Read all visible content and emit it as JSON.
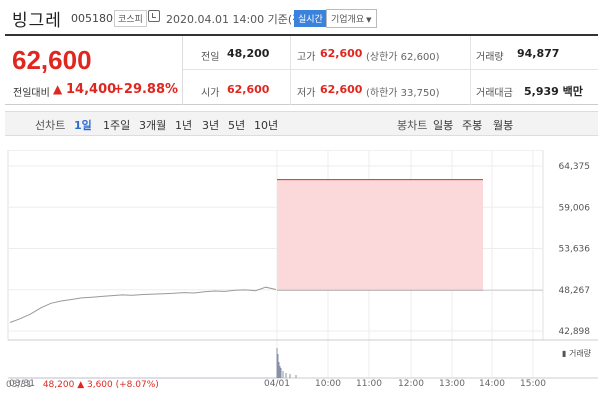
{
  "stock": {
    "name": "빙그레",
    "code": "005180",
    "market": "코스피",
    "timestamp": "2020.04.01 14:00 기준(장중)",
    "live_badge": "실시간",
    "company_button": "기업개요",
    "price": "62,600",
    "diff_label": "전일대비",
    "diff": "14,400",
    "pct": "+29.88%"
  },
  "summary": {
    "prev_close_label": "전일",
    "prev_close": "48,200",
    "high_label": "고가",
    "high": "62,600",
    "upper_limit_label": "(상한가 62,600)",
    "volume_label": "거래량",
    "volume": "94,877",
    "open_label": "시가",
    "open": "62,600",
    "low_label": "저가",
    "low": "62,600",
    "lower_limit_label": "(하한가 33,750)",
    "turnover_label": "거래대금",
    "turnover": "5,939 백만"
  },
  "toolbar": {
    "line_chart_label": "선차트",
    "periods": [
      "1일",
      "1주일",
      "3개월",
      "1년",
      "3년",
      "5년",
      "10년"
    ],
    "selected_period": "1일",
    "candle_chart_label": "봉차트",
    "candle_periods": [
      "일봉",
      "주봉",
      "월봉"
    ]
  },
  "chart_data": {
    "type": "line",
    "y_ticks": [
      "64,375",
      "59,006",
      "53,636",
      "48,267",
      "42,898"
    ],
    "ylim": [
      42898,
      64375
    ],
    "x_ticks": [
      "03/31",
      "04/01",
      "10:00",
      "11:00",
      "12:00",
      "13:00",
      "14:00",
      "15:00"
    ],
    "prev_day_series": [
      44000,
      44500,
      45100,
      45900,
      46500,
      46800,
      47000,
      47200,
      47300,
      47400,
      47500,
      47600,
      47550,
      47650,
      47700,
      47750,
      47800,
      47900,
      47850,
      48000,
      48100,
      48050,
      48200,
      48250,
      48150,
      48600,
      48300
    ],
    "upper_limit": 62600,
    "prev_close": 48200,
    "volume_legend": "거래량",
    "footer": {
      "date": "03/31",
      "price": "48,200",
      "arrow": "▲",
      "change": "3,600",
      "pct": "(+8.07%)"
    },
    "colors": {
      "line": "#999999",
      "limit_line": "#e0271f",
      "limit_fill": "#fbd9da",
      "volume": "#8a8fa8"
    }
  }
}
